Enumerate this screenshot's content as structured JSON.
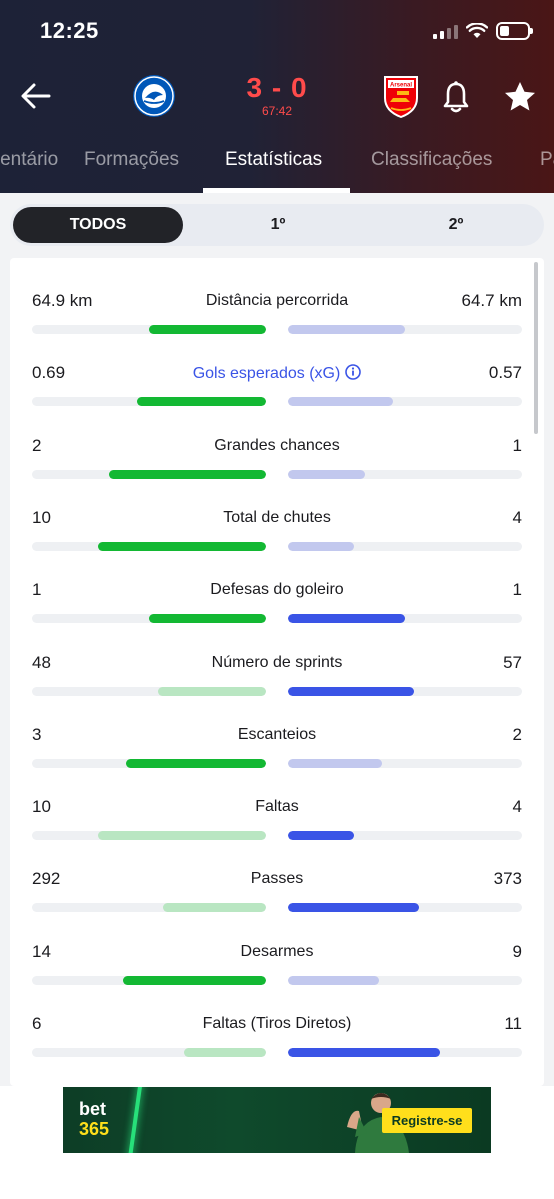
{
  "status_bar": {
    "time": "12:25"
  },
  "match": {
    "home_team": "Brighton & Hove Albion",
    "away_team": "Arsenal",
    "score": "3 - 0",
    "clock": "67:42",
    "crest_home_text": "BRIGHTON & HOVE ALBION",
    "crest_away_text": "Arsenal"
  },
  "tabs": [
    {
      "label": "Comentário"
    },
    {
      "label": "Formações"
    },
    {
      "label": "Estatísticas",
      "active": true
    },
    {
      "label": "Classificações"
    },
    {
      "label": "Partidas"
    }
  ],
  "period_selector": [
    {
      "label": "TODOS",
      "active": true
    },
    {
      "label": "1º"
    },
    {
      "label": "2º"
    }
  ],
  "stats": [
    {
      "label": "Distância percorrida",
      "home": "64.9 km",
      "away": "64.7 km",
      "home_share": 0.5,
      "away_share": 0.5,
      "highlight": "home"
    },
    {
      "label": "Gols esperados (xG)",
      "home": "0.69",
      "away": "0.57",
      "home_share": 0.55,
      "away_share": 0.45,
      "highlight": "home",
      "info_link": true
    },
    {
      "label": "Grandes chances",
      "home": "2",
      "away": "1",
      "home_share": 0.67,
      "away_share": 0.33,
      "highlight": "home"
    },
    {
      "label": "Total de chutes",
      "home": "10",
      "away": "4",
      "home_share": 0.72,
      "away_share": 0.28,
      "highlight": "home"
    },
    {
      "label": "Defesas do goleiro",
      "home": "1",
      "away": "1",
      "home_share": 0.5,
      "away_share": 0.5,
      "highlight": "both"
    },
    {
      "label": "Número de sprints",
      "home": "48",
      "away": "57",
      "home_share": 0.46,
      "away_share": 0.54,
      "highlight": "away"
    },
    {
      "label": "Escanteios",
      "home": "3",
      "away": "2",
      "home_share": 0.6,
      "away_share": 0.4,
      "highlight": "home"
    },
    {
      "label": "Faltas",
      "home": "10",
      "away": "4",
      "home_share": 0.72,
      "away_share": 0.28,
      "highlight": "away"
    },
    {
      "label": "Passes",
      "home": "292",
      "away": "373",
      "home_share": 0.44,
      "away_share": 0.56,
      "highlight": "away"
    },
    {
      "label": "Desarmes",
      "home": "14",
      "away": "9",
      "home_share": 0.61,
      "away_share": 0.39,
      "highlight": "home"
    },
    {
      "label": "Faltas (Tiros Diretos)",
      "home": "6",
      "away": "11",
      "home_share": 0.35,
      "away_share": 0.65,
      "highlight": "away"
    }
  ],
  "colors": {
    "home_strong": "#13b833",
    "home_light": "#b9e6c2",
    "away_strong": "#3a54e6",
    "away_light": "#c2c8ee",
    "accent_red": "#ff4b4b"
  },
  "ad": {
    "brand_top": "bet",
    "brand_bottom": "365",
    "cta": "Registre-se"
  }
}
